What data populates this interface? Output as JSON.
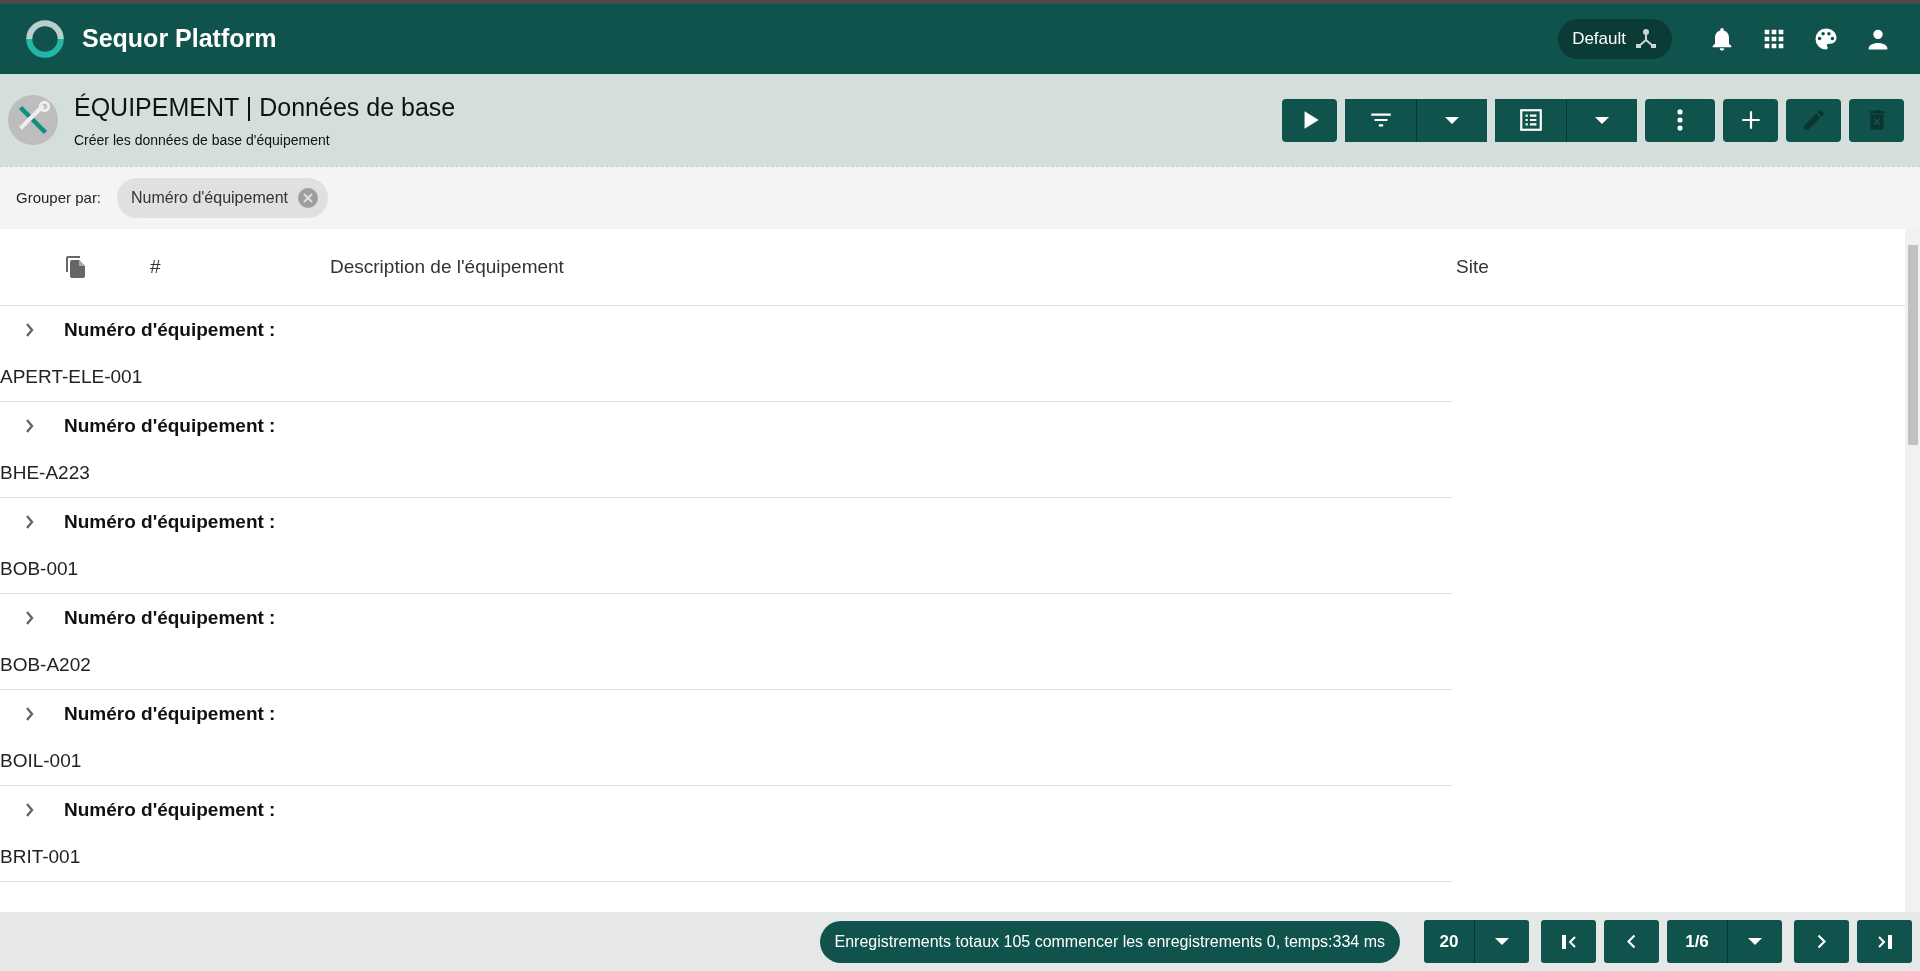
{
  "app": {
    "title": "Sequor Platform"
  },
  "topbar": {
    "context_chip": "Default"
  },
  "page": {
    "title": "ÉQUIPEMENT | Données de base",
    "subtitle": "Créer les données de base d'équipement"
  },
  "toolbar": [
    {
      "kind": "run",
      "disabled": false
    },
    {
      "kind": "filter",
      "disabled": false
    },
    {
      "kind": "view",
      "disabled": false
    },
    {
      "kind": "more",
      "disabled": false
    },
    {
      "kind": "add",
      "disabled": false
    },
    {
      "kind": "edit",
      "disabled": true
    },
    {
      "kind": "delete",
      "disabled": true
    }
  ],
  "group_by": {
    "label": "Grouper par:",
    "chips": [
      "Numéro d'équipement"
    ]
  },
  "table": {
    "columns": [
      {
        "kind": "icon"
      },
      {
        "kind": "text",
        "label": "#"
      },
      {
        "kind": "text",
        "label": "Description de l'équipement"
      },
      {
        "kind": "text",
        "label": "Site"
      }
    ],
    "groups": [
      {
        "label": "Numéro d'équipement :",
        "value": "APERT-ELE-001",
        "expanded": false
      },
      {
        "label": "Numéro d'équipement :",
        "value": "BHE-A223",
        "expanded": false
      },
      {
        "label": "Numéro d'équipement :",
        "value": "BOB-001",
        "expanded": false
      },
      {
        "label": "Numéro d'équipement :",
        "value": "BOB-A202",
        "expanded": false
      },
      {
        "label": "Numéro d'équipement :",
        "value": "BOIL-001",
        "expanded": false
      },
      {
        "label": "Numéro d'équipement :",
        "value": "BRIT-001",
        "expanded": false
      }
    ]
  },
  "footer": {
    "summary": "Enregistrements totaux 105 commencer les enregistrements 0, temps:334 ms",
    "page_size": "20",
    "page": "1/6"
  }
}
